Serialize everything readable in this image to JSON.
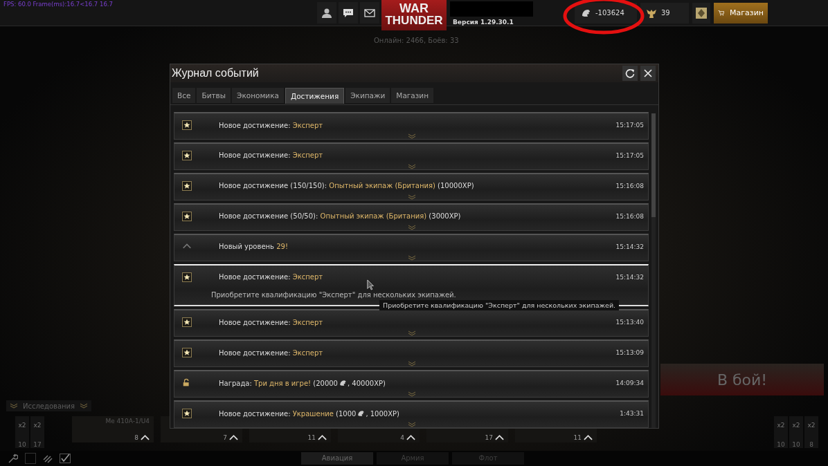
{
  "hud": {
    "fps": "FPS: 60.0 Frame(ms):16.7<16.7 16.7",
    "logo": [
      "WAR",
      "THUNDER"
    ],
    "version": "Версия 1.29.30.1",
    "online": "Онлайн: 2466, Боёв: 33",
    "silver": "-103624",
    "eagles": "39",
    "shop": "Магазин"
  },
  "window": {
    "title": "Журнал событий"
  },
  "tabs": [
    {
      "label": "Все",
      "selected": false
    },
    {
      "label": "Битвы",
      "selected": false
    },
    {
      "label": "Экономика",
      "selected": false
    },
    {
      "label": "Достижения",
      "selected": true
    },
    {
      "label": "Экипажи",
      "selected": false
    },
    {
      "label": "Магазин",
      "selected": false
    }
  ],
  "events": [
    {
      "kind": "star",
      "label": "Новое достижение: ",
      "name": "Эксперт",
      "time": "15:17:05",
      "expanded": false
    },
    {
      "kind": "star",
      "label": "Новое достижение: ",
      "name": "Эксперт",
      "time": "15:17:05",
      "expanded": false
    },
    {
      "kind": "star",
      "label": "Новое достижение (150/150): ",
      "name": "Опытный экипаж (Британия)",
      "suffix": [
        " (10000XP)"
      ],
      "time": "15:16:08",
      "expanded": false
    },
    {
      "kind": "star",
      "label": "Новое достижение (50/50): ",
      "name": "Опытный экипаж (Британия)",
      "suffix": [
        " (3000XP)"
      ],
      "time": "15:16:08",
      "expanded": false
    },
    {
      "kind": "level",
      "label": "Новый уровень ",
      "name": "29!",
      "time": "15:14:32",
      "expanded": false
    },
    {
      "kind": "star",
      "label": "Новое достижение: ",
      "name": "Эксперт",
      "time": "15:14:32",
      "expanded": true,
      "description": "Приобретите квалификацию \"Эксперт\" для нескольких экипажей."
    },
    {
      "kind": "star",
      "label": "Новое достижение: ",
      "name": "Эксперт",
      "time": "15:13:40",
      "expanded": false
    },
    {
      "kind": "star",
      "label": "Новое достижение: ",
      "name": "Эксперт",
      "time": "15:13:09",
      "expanded": false
    },
    {
      "kind": "reward",
      "label": "Награда: ",
      "name": "Три дня в игре!",
      "suffix": [
        " (20000",
        ", 40000XP)"
      ],
      "time": "14:09:34",
      "expanded": false
    },
    {
      "kind": "star",
      "label": "Новое достижение: ",
      "name": "Украшение",
      "suffix": [
        " (1000",
        ", 1000XP)"
      ],
      "time": "1:43:31",
      "expanded": false
    }
  ],
  "tooltip": "Приобретите квалификацию \"Эксперт\" для нескольких экипажей.",
  "research": {
    "title": "Исследования"
  },
  "left_slots": [
    {
      "count": "x2",
      "rank": "10"
    },
    {
      "count": "x2",
      "rank": "17"
    }
  ],
  "vehicles": [
    {
      "name": "Me 410A-1/U4",
      "rank": "8"
    },
    {
      "rank": "7"
    },
    {
      "rank": "11"
    },
    {
      "rank": "4"
    },
    {
      "rank": "17"
    },
    {
      "rank": "11"
    }
  ],
  "right_slots": [
    {
      "count": "x2",
      "rank": "10"
    },
    {
      "count": "x2",
      "rank": "10"
    },
    {
      "count": "x2",
      "rank": "8"
    }
  ],
  "battle_button": "В бой!",
  "unit_tabs": [
    {
      "label": "Авиация",
      "selected": true
    },
    {
      "label": "Армия",
      "selected": false
    },
    {
      "label": "Флот",
      "selected": false
    }
  ]
}
